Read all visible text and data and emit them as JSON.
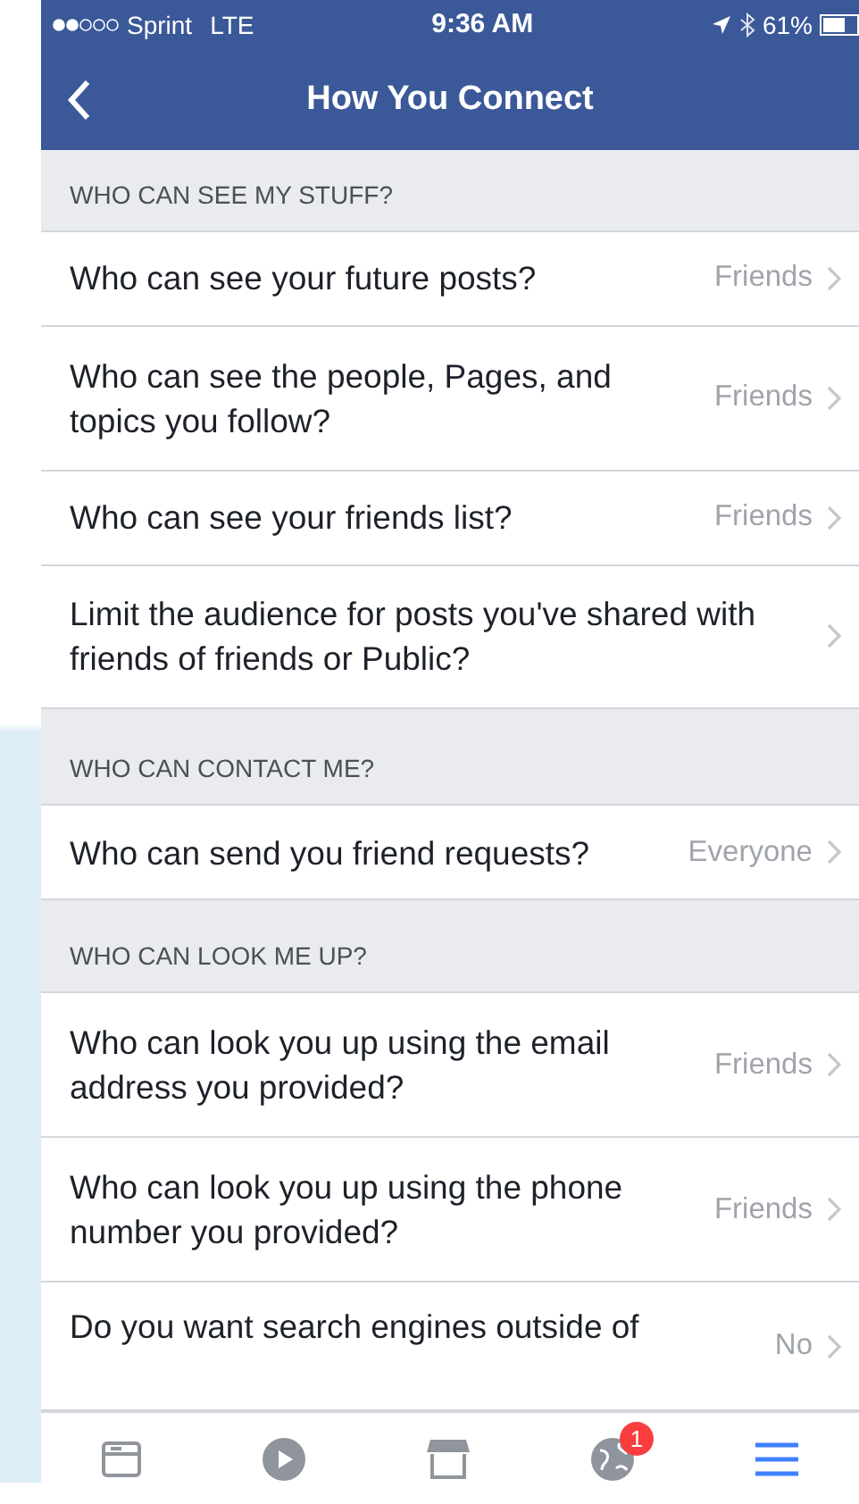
{
  "status_bar": {
    "carrier": "Sprint",
    "network": "LTE",
    "time": "9:36 AM",
    "battery": "61%"
  },
  "nav": {
    "title": "How You Connect"
  },
  "sections": [
    {
      "header": "WHO CAN SEE MY STUFF?",
      "rows": [
        {
          "label": "Who can see your future posts?",
          "value": "Friends"
        },
        {
          "label": "Who can see the people, Pages, and topics you follow?",
          "value": "Friends"
        },
        {
          "label": "Who can see your friends list?",
          "value": "Friends"
        },
        {
          "label": "Limit the audience for posts you've shared with friends of friends or Public?"
        }
      ]
    },
    {
      "header": "WHO CAN CONTACT ME?",
      "rows": [
        {
          "label": "Who can send you friend requests?",
          "value": "Everyone"
        }
      ]
    },
    {
      "header": "WHO CAN LOOK ME UP?",
      "rows": [
        {
          "label": "Who can look you up using the email address you provided?",
          "value": "Friends"
        },
        {
          "label": "Who can look you up using the phone number you provided?",
          "value": "Friends"
        },
        {
          "label": "Do you want search engines outside of",
          "value": "No",
          "cut": true
        }
      ]
    }
  ],
  "tab_bar": [
    {
      "kind": "feed",
      "selected": false
    },
    {
      "kind": "video",
      "selected": false
    },
    {
      "kind": "market",
      "selected": false
    },
    {
      "kind": "globe",
      "selected": false,
      "badge": "1"
    },
    {
      "kind": "menu",
      "selected": true
    }
  ]
}
